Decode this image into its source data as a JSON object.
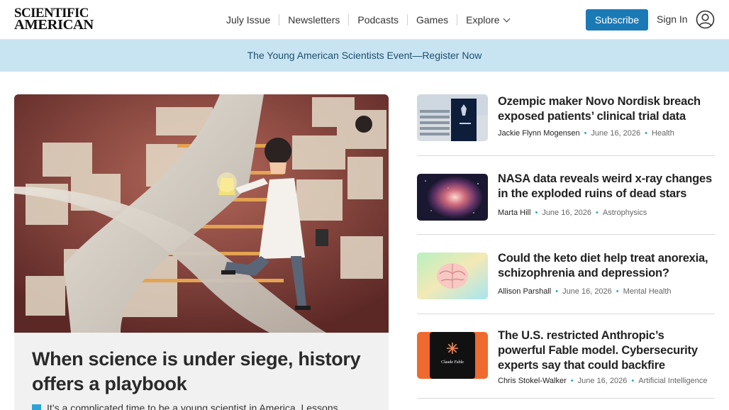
{
  "header": {
    "logo_line1": "SCIENTIFIC",
    "logo_line2": "AMERICAN",
    "nav": [
      "July Issue",
      "Newsletters",
      "Podcasts",
      "Games",
      "Explore"
    ],
    "subscribe_label": "Subscribe",
    "signin_label": "Sign In",
    "user_icon": "user-circle-icon",
    "explore_icon": "chevron-down-icon"
  },
  "banner": {
    "text": "The Young American Scientists Event—Register Now"
  },
  "hero": {
    "title": "When science is under siege, history offers a playbook",
    "dek": "It’s a complicated time to be a young scientist in America. Lessons",
    "accent_color": "#2ba3d6"
  },
  "stories": [
    {
      "title": "Ozempic maker Novo Nordisk breach exposed patients’ clinical trial data",
      "author": "Jackie Flynn Mogensen",
      "date": "June 16, 2026",
      "category": "Health"
    },
    {
      "title": "NASA data reveals weird x-ray changes in the exploded ruins of dead stars",
      "author": "Marta Hill",
      "date": "June 16, 2026",
      "category": "Astrophysics"
    },
    {
      "title": "Could the keto diet help treat anorexia, schizophrenia and depression?",
      "author": "Allison Parshall",
      "date": "June 16, 2026",
      "category": "Mental Health"
    },
    {
      "title": "The U.S. restricted Anthropic’s powerful Fable model. Cybersecurity experts say that could backfire",
      "author": "Chris Stokel-Walker",
      "date": "June 16, 2026",
      "category": "Artificial Intelligence",
      "thumb_text": "Claude Fable"
    }
  ],
  "colors": {
    "brand_blue": "#1b7ab5",
    "banner_bg": "#c8e4f3",
    "accent": "#2ba3d6"
  }
}
